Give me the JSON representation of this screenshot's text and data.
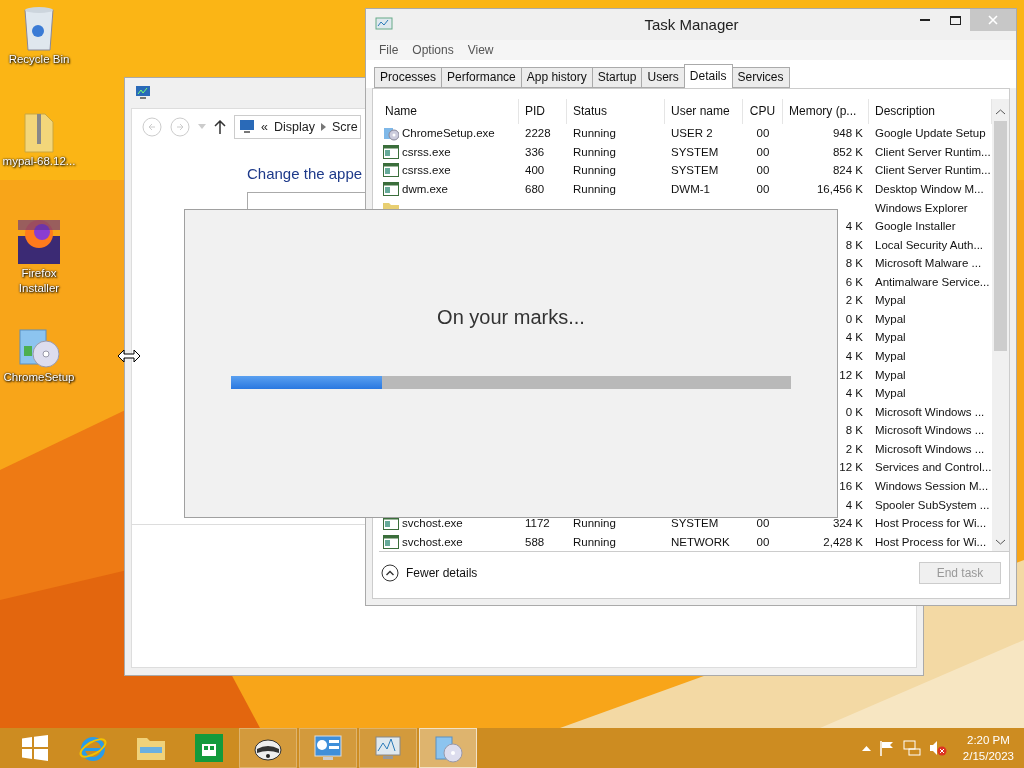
{
  "desktop_icons": [
    {
      "label": "Recycle Bin",
      "kind": "bin"
    },
    {
      "label": "mypal-68.12...",
      "kind": "zip"
    },
    {
      "label": "Firefox Installer",
      "kind": "firefox"
    },
    {
      "label": "ChromeSetup",
      "kind": "setup"
    }
  ],
  "explorer": {
    "breadcrumb": [
      "«",
      "Display",
      "Scre"
    ],
    "heading": "Change the appe"
  },
  "task_manager": {
    "title": "Task Manager",
    "menu": [
      "File",
      "Options",
      "View"
    ],
    "tabs": [
      {
        "label": "Processes",
        "selected": false
      },
      {
        "label": "Performance",
        "selected": false
      },
      {
        "label": "App history",
        "selected": false
      },
      {
        "label": "Startup",
        "selected": false
      },
      {
        "label": "Users",
        "selected": false
      },
      {
        "label": "Details",
        "selected": true
      },
      {
        "label": "Services",
        "selected": false
      }
    ],
    "columns": [
      "Name",
      "PID",
      "Status",
      "User name",
      "CPU",
      "Memory (p...",
      "Description"
    ],
    "rows": [
      {
        "kind": "setup",
        "name": "ChromeSetup.exe",
        "pid": "2228",
        "status": "Running",
        "user": "USER 2",
        "cpu": "00",
        "memory": "948 K",
        "description": "Google Update Setup"
      },
      {
        "kind": "window",
        "name": "csrss.exe",
        "pid": "336",
        "status": "Running",
        "user": "SYSTEM",
        "cpu": "00",
        "memory": "852 K",
        "description": "Client Server Runtim..."
      },
      {
        "kind": "window",
        "name": "csrss.exe",
        "pid": "400",
        "status": "Running",
        "user": "SYSTEM",
        "cpu": "00",
        "memory": "824 K",
        "description": "Client Server Runtim..."
      },
      {
        "kind": "window",
        "name": "dwm.exe",
        "pid": "680",
        "status": "Running",
        "user": "DWM-1",
        "cpu": "00",
        "memory": "16,456 K",
        "description": "Desktop Window M..."
      },
      {
        "kind": "folder",
        "description": "Windows Explorer"
      },
      {
        "memory": "4 K",
        "description": "Google Installer"
      },
      {
        "memory": "8 K",
        "description": "Local Security Auth..."
      },
      {
        "memory": "8 K",
        "description": "Microsoft Malware ..."
      },
      {
        "memory": "6 K",
        "description": "Antimalware Service..."
      },
      {
        "memory": "2 K",
        "description": "Mypal"
      },
      {
        "memory": "0 K",
        "description": "Mypal"
      },
      {
        "memory": "4 K",
        "description": "Mypal"
      },
      {
        "memory": "4 K",
        "description": "Mypal"
      },
      {
        "memory": "12 K",
        "description": "Mypal"
      },
      {
        "memory": "4 K",
        "description": "Mypal"
      },
      {
        "memory": "0 K",
        "description": "Microsoft Windows ..."
      },
      {
        "memory": "8 K",
        "description": "Microsoft Windows ..."
      },
      {
        "memory": "2 K",
        "description": "Microsoft Windows ..."
      },
      {
        "memory": "12 K",
        "description": "Services and Control..."
      },
      {
        "memory": "16 K",
        "description": "Windows Session M..."
      },
      {
        "memory": "4 K",
        "description": "Spooler SubSystem ..."
      },
      {
        "kind": "window",
        "name": "svchost.exe",
        "pid": "1172",
        "status": "Running",
        "user": "SYSTEM",
        "cpu": "00",
        "memory": "324 K",
        "description": "Host Process for Wi..."
      },
      {
        "kind": "window",
        "name": "svchost.exe",
        "pid": "588",
        "status": "Running",
        "user": "NETWORK",
        "cpu": "00",
        "memory": "2,428 K",
        "description": "Host Process for Wi..."
      }
    ],
    "fewer_details": "Fewer details",
    "end_task": {
      "label": "End task",
      "disabled": true
    }
  },
  "dialog": {
    "message": "On your marks...",
    "level": 0.27
  },
  "taskbar": {
    "apps": [
      {
        "kind": "ie",
        "active": false
      },
      {
        "kind": "explorer",
        "active": false
      },
      {
        "kind": "store",
        "active": false
      },
      {
        "kind": "raccoon",
        "active": false
      },
      {
        "kind": "control",
        "active": false
      },
      {
        "kind": "taskmgr",
        "active": false
      },
      {
        "kind": "setup",
        "active": true
      }
    ],
    "time": "2:20 PM",
    "date": "2/15/2023"
  }
}
